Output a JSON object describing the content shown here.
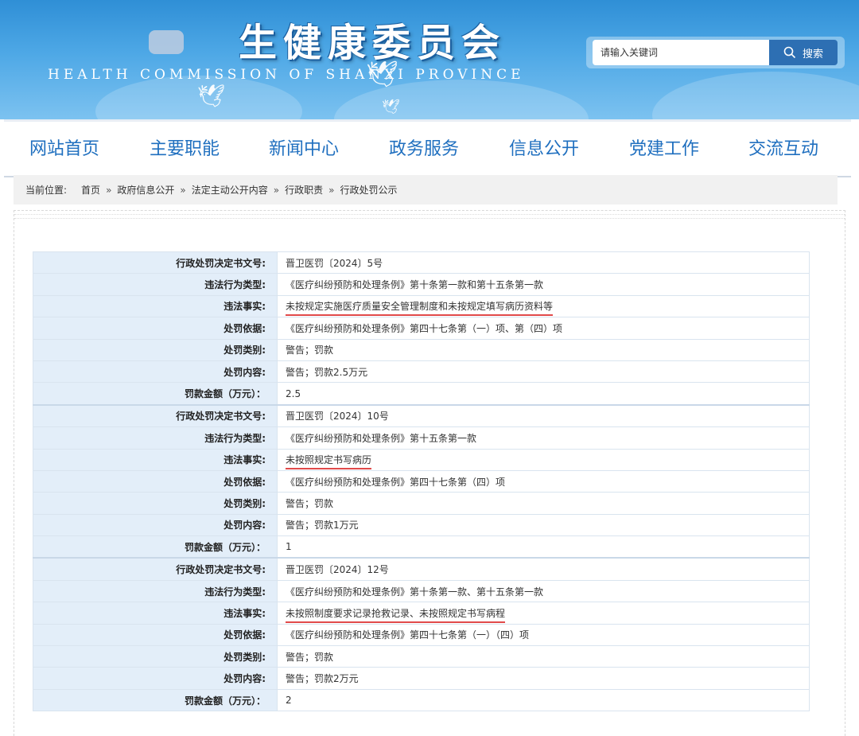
{
  "header": {
    "title": "生健康委员会",
    "subtitle": "HEALTH COMMISSION OF SHANXI PROVINCE",
    "search": {
      "placeholder": "请输入关键词",
      "button_label": "搜索",
      "icon": "search-icon"
    }
  },
  "nav": {
    "items": [
      "网站首页",
      "主要职能",
      "新闻中心",
      "政务服务",
      "信息公开",
      "党建工作",
      "交流互动"
    ]
  },
  "breadcrumb": {
    "label": "当前位置:",
    "separator": "»",
    "items": [
      "首页",
      "政府信息公开",
      "法定主动公开内容",
      "行政职责",
      "行政处罚公示"
    ]
  },
  "records": [
    {
      "rows": [
        {
          "label": "行政处罚决定书文号:",
          "value": "晋卫医罚〔2024〕5号"
        },
        {
          "label": "违法行为类型:",
          "value": "《医疗纠纷预防和处理条例》第十条第一款和第十五条第一款"
        },
        {
          "label": "违法事实:",
          "value": "未按规定实施医疗质量安全管理制度和未按规定填写病历资料等"
        },
        {
          "label": "处罚依据:",
          "value": "《医疗纠纷预防和处理条例》第四十七条第（一）项、第（四）项"
        },
        {
          "label": "处罚类别:",
          "value": "警告；罚款"
        },
        {
          "label": "处罚内容:",
          "value": "警告；罚款2.5万元"
        },
        {
          "label": "罚款金额（万元）：",
          "value": "2.5"
        }
      ]
    },
    {
      "rows": [
        {
          "label": "行政处罚决定书文号:",
          "value": "晋卫医罚〔2024〕10号"
        },
        {
          "label": "违法行为类型:",
          "value": "《医疗纠纷预防和处理条例》第十五条第一款"
        },
        {
          "label": "违法事实:",
          "value": "未按照规定书写病历"
        },
        {
          "label": "处罚依据:",
          "value": "《医疗纠纷预防和处理条例》第四十七条第（四）项"
        },
        {
          "label": "处罚类别:",
          "value": "警告；罚款"
        },
        {
          "label": "处罚内容:",
          "value": "警告；罚款1万元"
        },
        {
          "label": "罚款金额（万元）：",
          "value": "1"
        }
      ]
    },
    {
      "rows": [
        {
          "label": "行政处罚决定书文号:",
          "value": "晋卫医罚〔2024〕12号"
        },
        {
          "label": "违法行为类型:",
          "value": "《医疗纠纷预防和处理条例》第十条第一款、第十五条第一款"
        },
        {
          "label": "违法事实:",
          "value": "未按照制度要求记录抢救记录、未按照规定书写病程"
        },
        {
          "label": "处罚依据:",
          "value": "《医疗纠纷预防和处理条例》第四十七条第（一）（四）项"
        },
        {
          "label": "处罚类别:",
          "value": "警告；罚款"
        },
        {
          "label": "处罚内容:",
          "value": "警告；罚款2万元"
        },
        {
          "label": "罚款金额（万元）：",
          "value": "2"
        }
      ]
    }
  ],
  "colors": {
    "header_blue": "#2f8fd6",
    "nav_text": "#1f6fbf",
    "label_bg": "#e3eef9",
    "underline_red": "#e14a4a",
    "search_button": "#2d6fb3"
  }
}
